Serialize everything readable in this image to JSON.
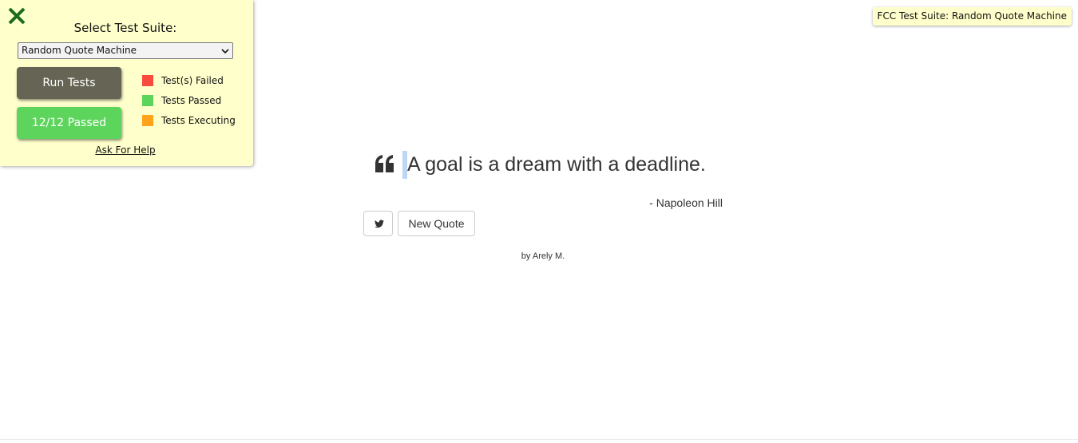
{
  "fcc_panel": {
    "close_icon": "close-x-icon",
    "title": "Select Test Suite:",
    "suite_select": {
      "selected": "Random Quote Machine"
    },
    "run_button_label": "Run Tests",
    "passed_button_label": "12/12 Passed",
    "legend": [
      {
        "label": "Test(s) Failed",
        "color": "#f94a3e"
      },
      {
        "label": "Tests Passed",
        "color": "#5dd55d"
      },
      {
        "label": "Tests Executing",
        "color": "#ffa31a"
      }
    ],
    "help_link": "Ask For Help"
  },
  "tooltip": {
    "text": "FCC Test Suite: Random Quote Machine"
  },
  "quote": {
    "icon": "quote-left-icon",
    "text": "A goal is a dream with a deadline.",
    "author": "- Napoleon Hill",
    "tweet_icon": "twitter-icon",
    "new_quote_label": "New Quote"
  },
  "footer": {
    "byline": "by Arely M."
  },
  "colors": {
    "panel_background": "#ffffcc",
    "run_button": "#656455",
    "passed_button": "#5dd55d",
    "close_icon": "#1a6b1a"
  }
}
